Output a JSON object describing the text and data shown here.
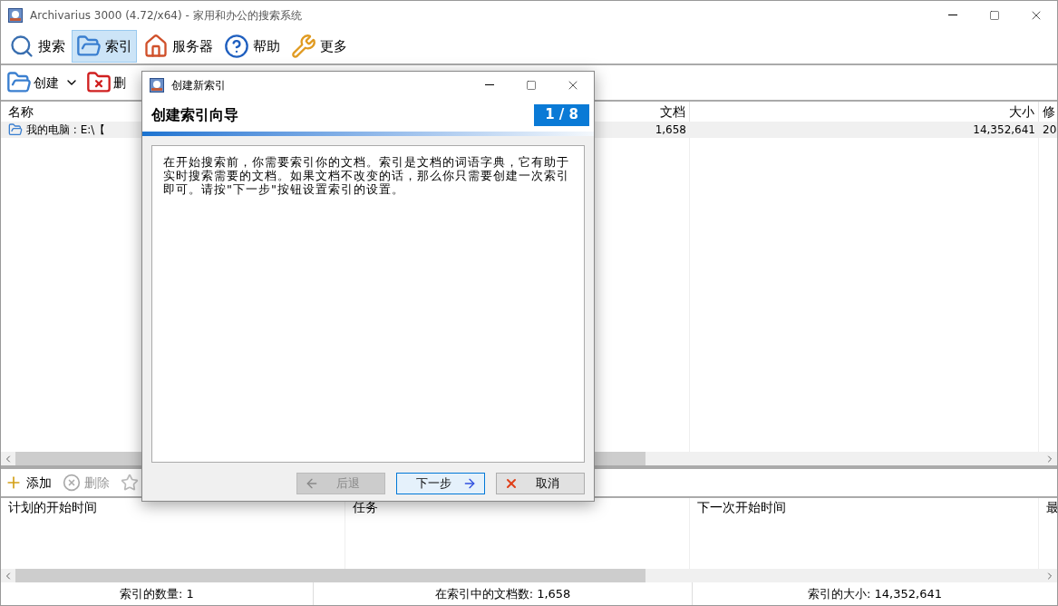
{
  "window": {
    "title": "Archivarius 3000 (4.72/x64) - 家用和办公的搜索系统"
  },
  "main_toolbar": [
    {
      "kind": "search",
      "label": "搜索",
      "selected": false
    },
    {
      "kind": "index",
      "label": "索引",
      "selected": true
    },
    {
      "kind": "server",
      "label": "服务器",
      "selected": false
    },
    {
      "kind": "help",
      "label": "帮助",
      "selected": false
    },
    {
      "kind": "more",
      "label": "更多",
      "selected": false
    }
  ],
  "index_toolbar": [
    {
      "kind": "create",
      "label": "创建"
    },
    {
      "kind": "delete",
      "label": "删"
    }
  ],
  "index_table": {
    "columns": [
      "名称",
      "文档",
      "大小",
      "修"
    ],
    "rows": [
      {
        "selected": true,
        "cells": [
          "我的电脑 : E:\\【",
          "1,658",
          "14,352,641",
          "20"
        ]
      }
    ]
  },
  "task_toolbar": [
    {
      "kind": "add",
      "label": "添加",
      "disabled": false
    },
    {
      "kind": "delete",
      "label": "删除",
      "disabled": true
    }
  ],
  "task_table": {
    "columns": [
      "计划的开始时间",
      "任务",
      "下一次开始时间",
      "最"
    ]
  },
  "status_bar": [
    "索引的数量: 1",
    "在索引中的文档数: 1,658",
    "索引的大小: 14,352,641"
  ],
  "dialog": {
    "title": "创建新索引",
    "heading": "创建索引向导",
    "step": "1 / 8",
    "text": "在开始搜索前，你需要索引你的文档。索引是文档的词语字典，它有助于实时搜索需要的文档。如果文档不改变的话，那么你只需要创建一次索引即可。请按\"下一步\"按钮设置索引的设置。",
    "buttons": [
      {
        "kind": "back",
        "label": "后退",
        "disabled": true,
        "focused": false
      },
      {
        "kind": "next",
        "label": "下一步",
        "disabled": false,
        "focused": true
      },
      {
        "kind": "cancel",
        "label": "取消",
        "disabled": false,
        "focused": false
      }
    ]
  }
}
